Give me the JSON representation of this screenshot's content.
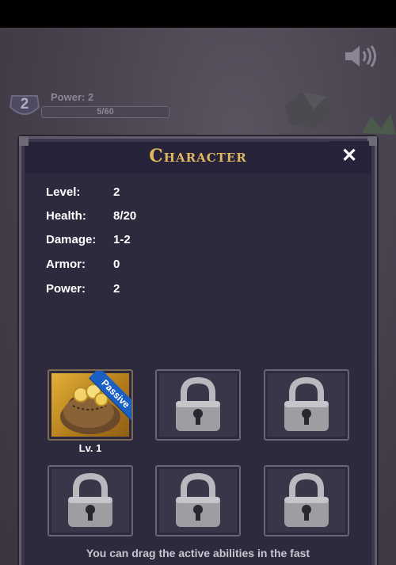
{
  "hud": {
    "level_badge": "2",
    "power_label": "Power: 2",
    "xp_text": "5/60",
    "xp_fraction": 0.0833
  },
  "dialog": {
    "title": "Character",
    "close_label": "✕",
    "stats": [
      {
        "label": "Level:",
        "value": "2"
      },
      {
        "label": "Health:",
        "value": "8/20"
      },
      {
        "label": "Damage:",
        "value": "1-2"
      },
      {
        "label": "Armor:",
        "value": "0"
      },
      {
        "label": "Power:",
        "value": "2"
      }
    ],
    "abilities": [
      {
        "state": "unlocked",
        "icon": "coin-bag-icon",
        "badge": "Passive",
        "level_label": "Lv. 1"
      },
      {
        "state": "locked",
        "icon": "padlock-icon"
      },
      {
        "state": "locked",
        "icon": "padlock-icon"
      },
      {
        "state": "locked",
        "icon": "padlock-icon"
      },
      {
        "state": "locked",
        "icon": "padlock-icon"
      },
      {
        "state": "locked",
        "icon": "padlock-icon"
      }
    ],
    "hint": "You can drag the active abilities in the fast"
  },
  "colors": {
    "title": "#e2b760",
    "panel": "#2e2a3e",
    "ribbon": "#1b5fc4",
    "text": "#ffffff"
  }
}
